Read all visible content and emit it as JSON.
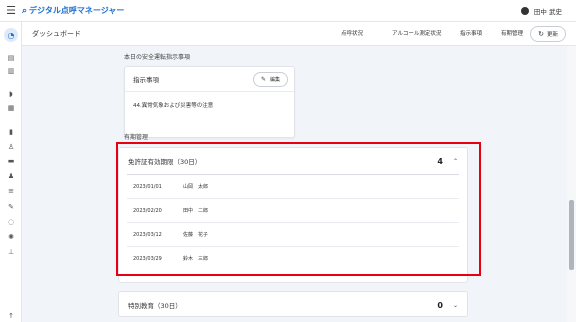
{
  "brand": {
    "name": "デジタル点呼マネージャー"
  },
  "user": {
    "name": "田中 武史"
  },
  "header": {
    "title": "ダッシュボード",
    "nav": [
      "点呼状況",
      "アルコール測定状況",
      "指示事項",
      "有期管理"
    ],
    "refresh_label": "更新"
  },
  "instructions_section": {
    "title": "本日の安全運転指示事項",
    "card_title": "指示事項",
    "edit_label": "編集",
    "item": "44.異常気象および災害等の注意"
  },
  "period_section": {
    "title": "有期管理",
    "license": {
      "title": "免許証有効期限（30日）",
      "count": "4",
      "rows": [
        {
          "date": "2023/01/01",
          "name": "山岡　太郎"
        },
        {
          "date": "2023/02/20",
          "name": "田中　二郎"
        },
        {
          "date": "2023/03/12",
          "name": "佐藤　花子"
        },
        {
          "date": "2023/03/29",
          "name": "鈴木　三郎"
        }
      ]
    },
    "special_education": {
      "title": "特別教育（30日）",
      "count": "0"
    }
  },
  "colors": {
    "accent": "#1c6fd1",
    "highlight": "#e60012"
  },
  "icons": [
    "menu-icon",
    "search-icon",
    "user-icon",
    "dashboard-icon",
    "refresh-icon",
    "pencil-icon",
    "chevron-up-icon",
    "chevron-down-icon"
  ]
}
